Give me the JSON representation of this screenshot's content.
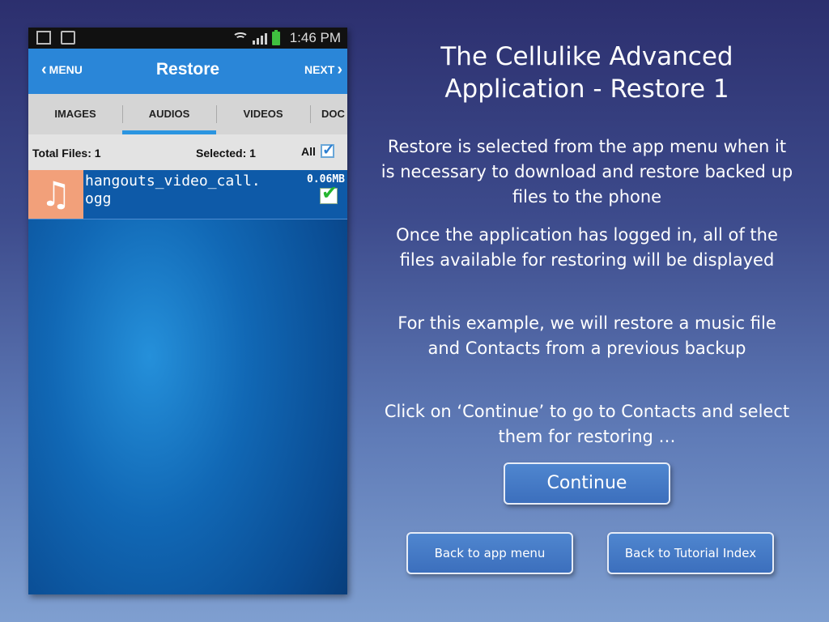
{
  "phone": {
    "status_bar": {
      "time": "1:46 PM"
    },
    "app_bar": {
      "menu_label": "MENU",
      "title": "Restore",
      "next_label": "NEXT"
    },
    "tabs": [
      {
        "label": "IMAGES",
        "active": false
      },
      {
        "label": "AUDIOS",
        "active": true
      },
      {
        "label": "VIDEOS",
        "active": false
      },
      {
        "label": "DOC",
        "active": false
      }
    ],
    "summary": {
      "total_files": "Total Files: 1",
      "selected": "Selected: 1",
      "all_label": "All",
      "all_checked": true
    },
    "files": [
      {
        "name": "hangouts_video_call.\nogg",
        "size": "0.06MB",
        "checked": true,
        "icon": "music-note-icon"
      }
    ]
  },
  "slide": {
    "title": "The Cellulike Advanced Application - Restore 1",
    "paragraphs": [
      "Restore is selected from the app menu when it is necessary to download and restore backed up files to the phone",
      "Once the application has logged in, all of the files available for restoring will be displayed",
      "For this example, we will restore a music file and Contacts from a previous backup",
      "Click on ‘Continue’ to go to Contacts and select them for restoring …"
    ],
    "buttons": {
      "continue": "Continue",
      "back_app_menu": "Back to app menu",
      "back_tutorial_index": "Back to Tutorial Index"
    }
  },
  "colors": {
    "app_bar": "#2a86d8",
    "tab_indicator": "#2b95e0",
    "file_row": "#0e5aa8",
    "music_tile": "#f2a07a",
    "button": "#4579c6"
  }
}
